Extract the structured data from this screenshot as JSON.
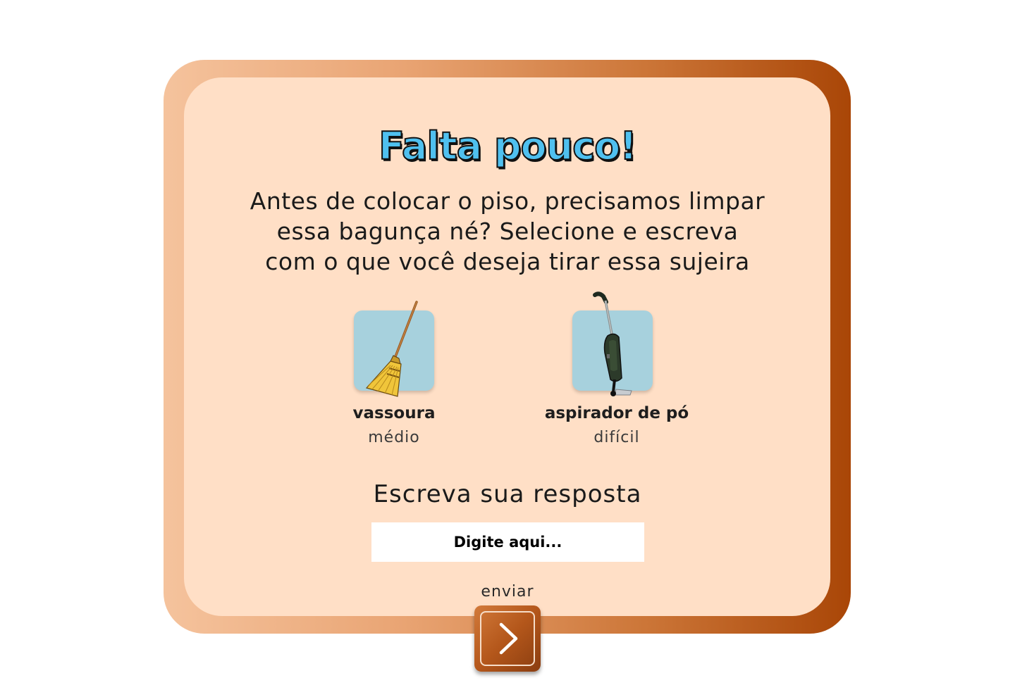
{
  "title": "Falta pouco!",
  "instructions": {
    "line1": "Antes de colocar o piso, precisamos limpar",
    "line2": "essa bagunça né? Selecione e escreva",
    "line3": "com o que você deseja tirar essa sujeira"
  },
  "options": [
    {
      "name": "vassoura",
      "level": "médio",
      "icon": "broom-icon"
    },
    {
      "name": "aspirador de pó",
      "level": "difícil",
      "icon": "vacuum-cleaner-icon"
    }
  ],
  "answer": {
    "label": "Escreva sua resposta",
    "placeholder": "Digite aqui...",
    "value": ""
  },
  "submit": {
    "label": "enviar",
    "icon": "chevron-right-icon"
  },
  "colors": {
    "frame_gradient_start": "#f5c39d",
    "frame_gradient_end": "#a94607",
    "panel_bg": "#ffdfc6",
    "title_fill": "#4fc0ef",
    "card_bg": "#a7d1dd",
    "button_bg": "#b4571b"
  }
}
